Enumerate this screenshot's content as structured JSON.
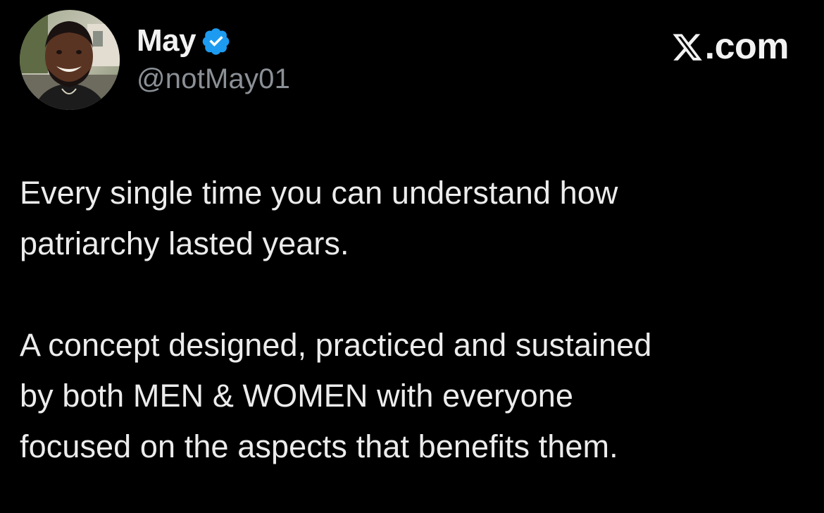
{
  "author": {
    "display_name": "May",
    "handle": "@notMay01",
    "verified": true,
    "verified_color": "#1d9bf0"
  },
  "brand": {
    "label": ".com",
    "icon": "x-logo-icon"
  },
  "tweet": {
    "paragraphs": [
      "Every single time you can understand how\npatriarchy lasted years.",
      "A concept designed, practiced and sustained\nby both MEN & WOMEN with everyone\nfocused on the aspects that benefits them."
    ]
  },
  "colors": {
    "background": "#000000",
    "text": "#e7e9ea",
    "secondary_text": "#8b9096"
  }
}
